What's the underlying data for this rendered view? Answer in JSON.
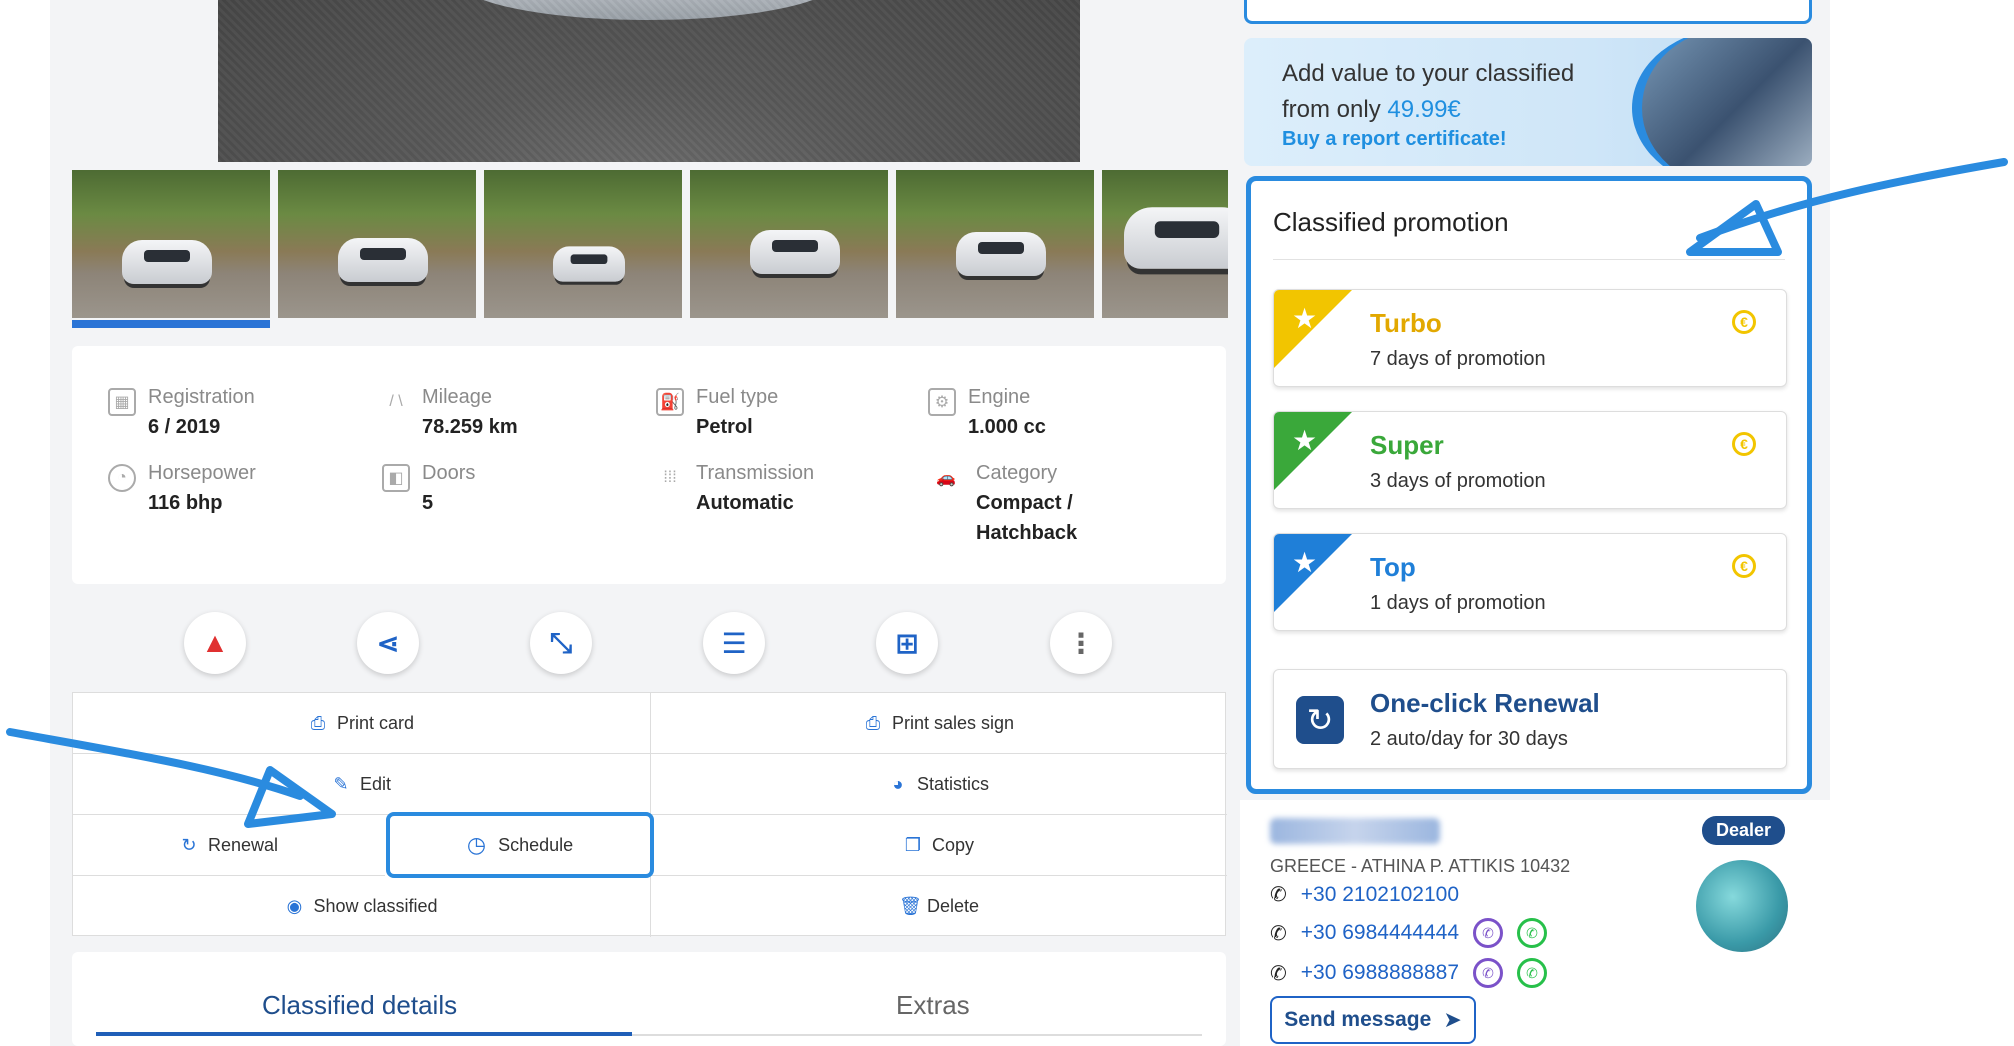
{
  "specs": [
    {
      "label": "Registration",
      "value": "6 / 2019",
      "icon": "calendar-icon"
    },
    {
      "label": "Mileage",
      "value": "78.259 km",
      "icon": "road-icon"
    },
    {
      "label": "Fuel type",
      "value": "Petrol",
      "icon": "fuel-pump-icon"
    },
    {
      "label": "Engine",
      "value": "1.000 cc",
      "icon": "engine-icon"
    },
    {
      "label": "Horsepower",
      "value": "116 bhp",
      "icon": "gauge-icon"
    },
    {
      "label": "Doors",
      "value": "5",
      "icon": "door-icon"
    },
    {
      "label": "Transmission",
      "value": "Automatic",
      "icon": "gearbox-icon"
    },
    {
      "label": "Category",
      "value": "Compact / Hatchback",
      "value_line1": "Compact /",
      "value_line2": "Hatchback",
      "icon": "car-icon"
    }
  ],
  "actions": {
    "print_card": "Print card",
    "print_sales_sign": "Print sales sign",
    "edit": "Edit",
    "statistics": "Statistics",
    "renewal": "Renewal",
    "schedule": "Schedule",
    "copy": "Copy",
    "show_classified": "Show classified",
    "delete": "Delete"
  },
  "tabs": {
    "details": "Classified details",
    "extras": "Extras"
  },
  "banner": {
    "line1": "Add value to your classified",
    "line2_prefix": "from only ",
    "price": "49.99€",
    "cta": "Buy a report certificate!"
  },
  "promotion": {
    "title": "Classified promotion",
    "options": [
      {
        "name": "Turbo",
        "desc": "7 days of promotion",
        "color": "#f2c500",
        "text_color": "#e2a800"
      },
      {
        "name": "Super",
        "desc": "3 days of promotion",
        "color": "#3aa83a",
        "text_color": "#3aa83a"
      },
      {
        "name": "Top",
        "desc": "1 days of promotion",
        "color": "#1f7fd8",
        "text_color": "#1f7fd8"
      }
    ],
    "renewal": {
      "name": "One-click Renewal",
      "desc": "2 auto/day for 30 days"
    }
  },
  "dealer": {
    "badge": "Dealer",
    "address": "GREECE - ATHINA P. ATTIKIS 10432",
    "phones": [
      "+30 2102102100",
      "+30 6984444444",
      "+30 6988888887"
    ],
    "send_message": "Send message"
  },
  "colors": {
    "accent": "#2a8bdf",
    "brand": "#1f4e8c"
  }
}
